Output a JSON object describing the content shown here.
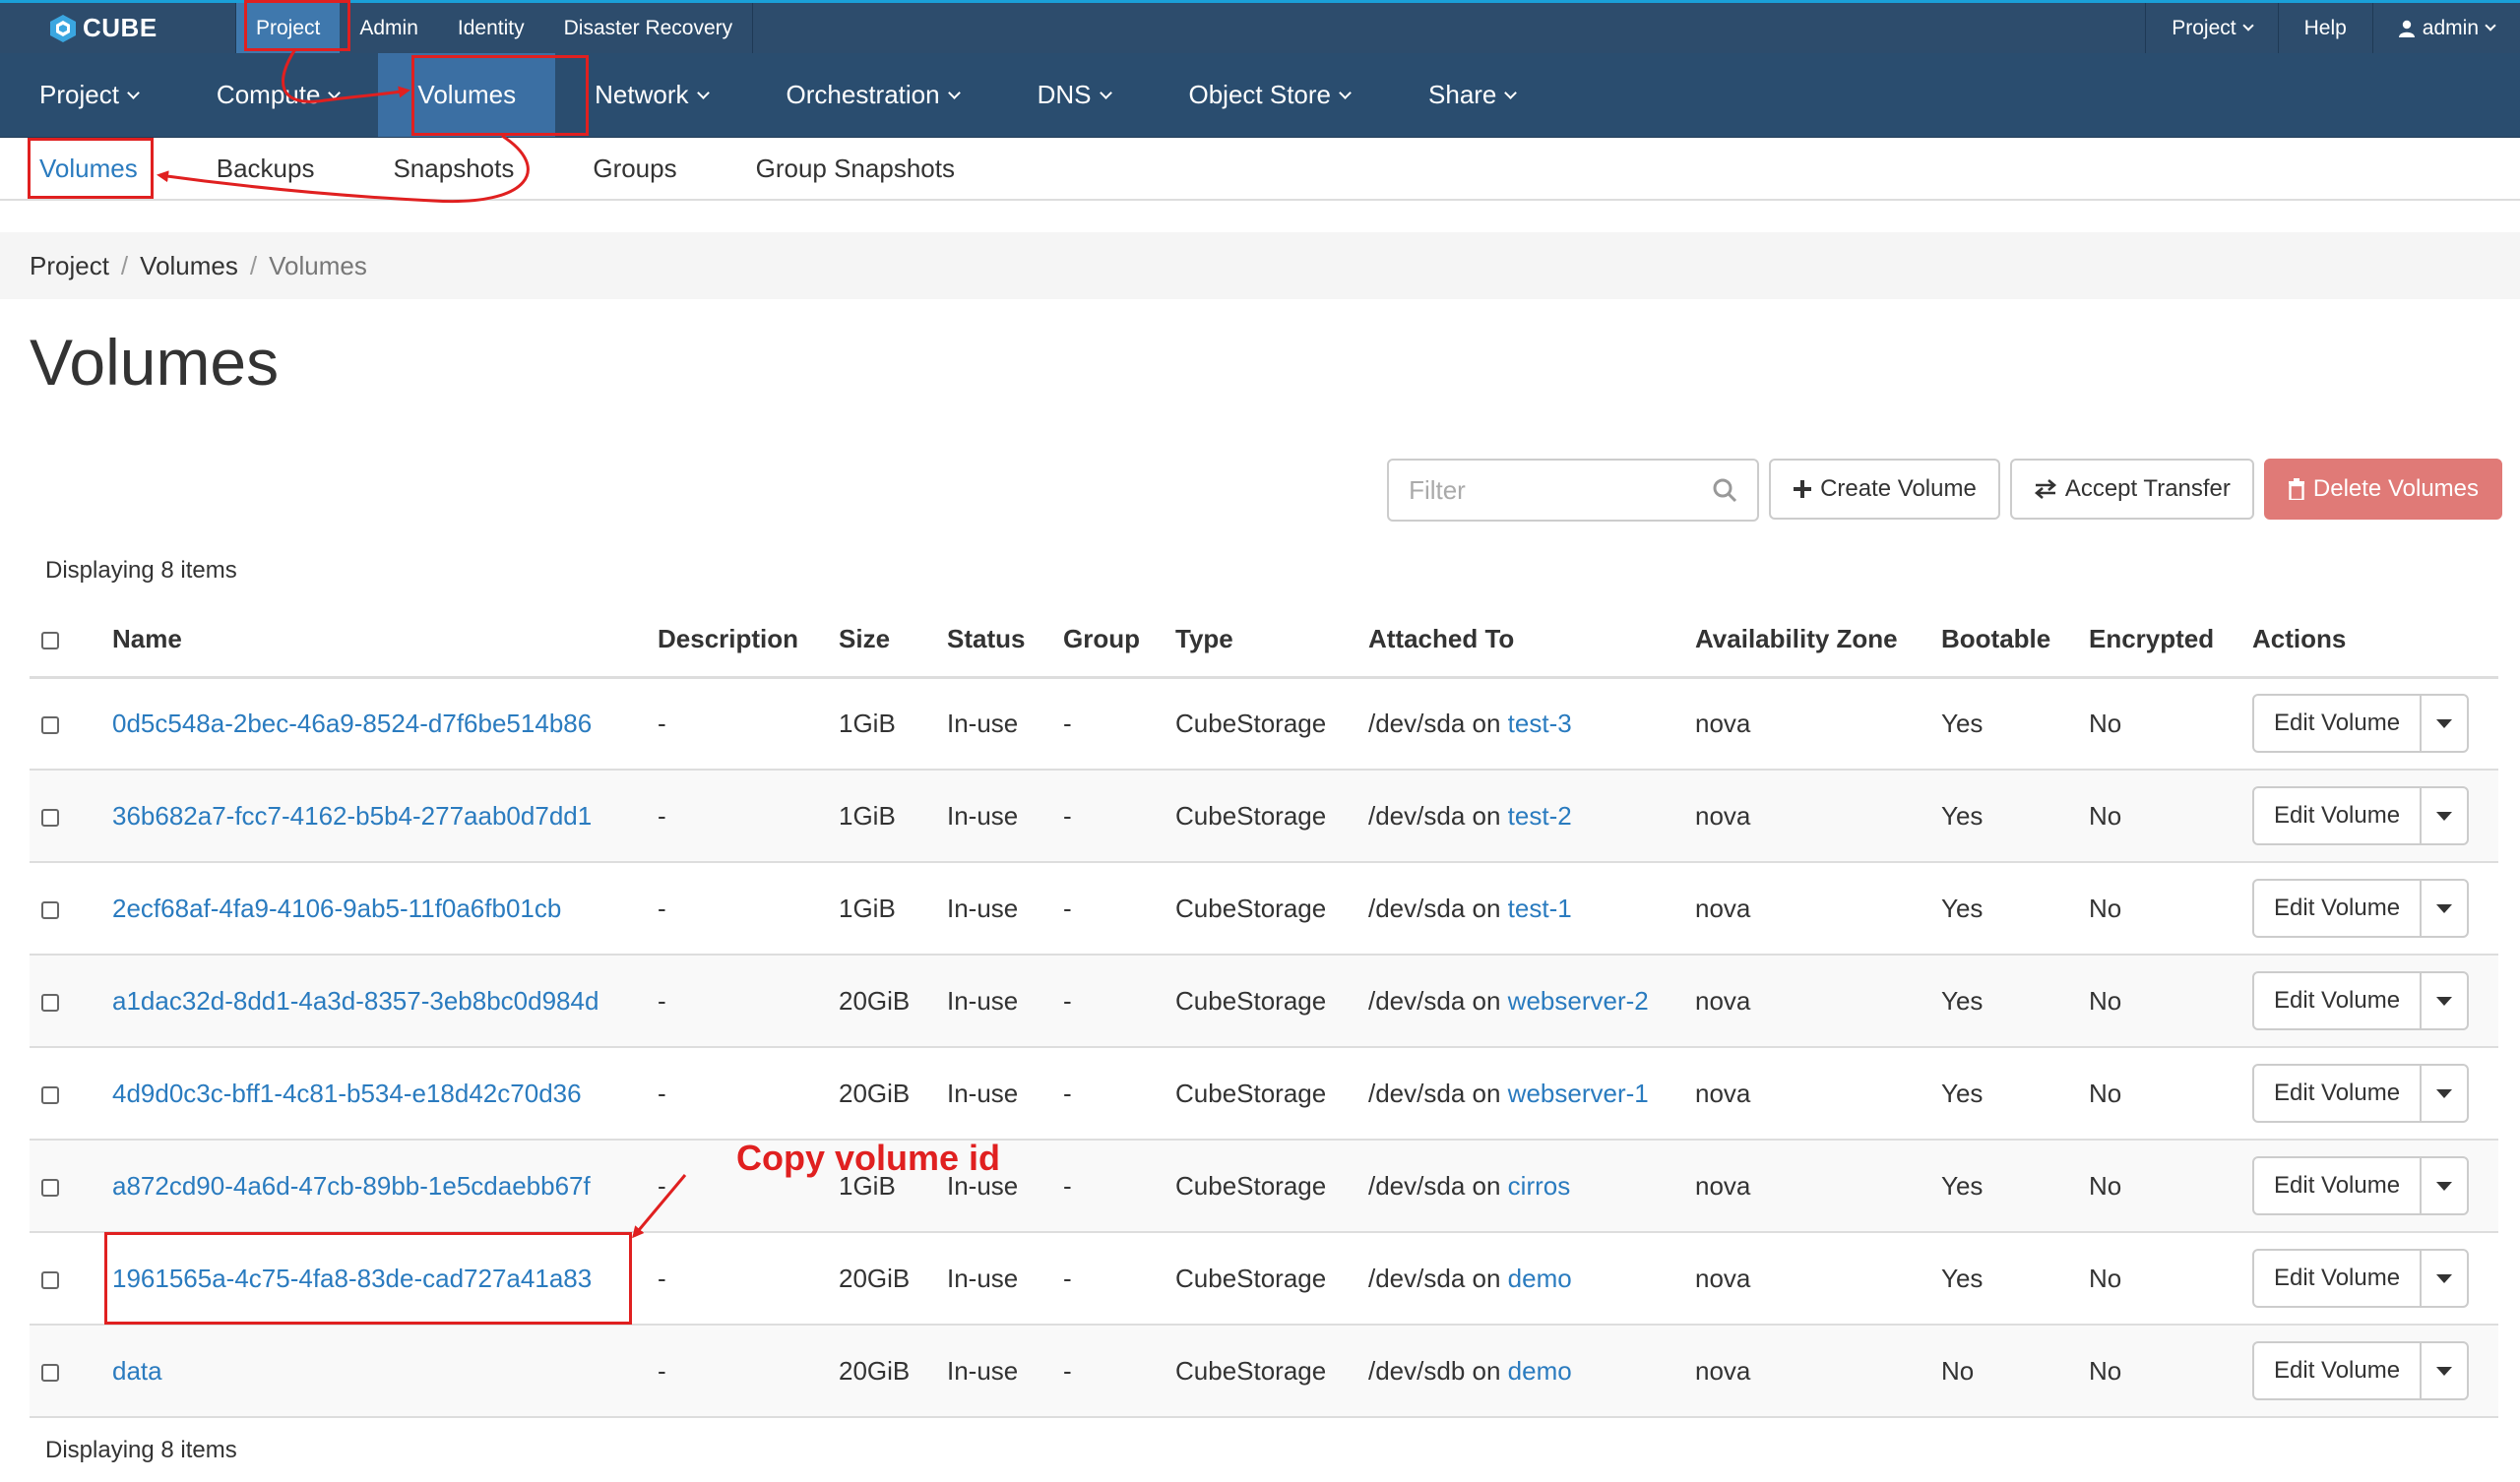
{
  "topbar": {
    "brand": "CUBE",
    "nav": [
      "Project",
      "Admin",
      "Identity",
      "Disaster Recovery"
    ],
    "right": {
      "project_menu": "Project",
      "help": "Help",
      "user": "admin"
    }
  },
  "mainnav": [
    "Project",
    "Compute",
    "Volumes",
    "Network",
    "Orchestration",
    "DNS",
    "Object Store",
    "Share"
  ],
  "subnav": [
    "Volumes",
    "Backups",
    "Snapshots",
    "Groups",
    "Group Snapshots"
  ],
  "breadcrumb": [
    "Project",
    "Volumes",
    "Volumes"
  ],
  "page_title": "Volumes",
  "toolbar": {
    "filter_placeholder": "Filter",
    "create": "Create Volume",
    "accept": "Accept Transfer",
    "delete": "Delete Volumes"
  },
  "count_text": "Displaying 8 items",
  "table": {
    "headers": [
      "Name",
      "Description",
      "Size",
      "Status",
      "Group",
      "Type",
      "Attached To",
      "Availability Zone",
      "Bootable",
      "Encrypted",
      "Actions"
    ],
    "action_label": "Edit Volume",
    "rows": [
      {
        "name": "0d5c548a-2bec-46a9-8524-d7f6be514b86",
        "desc": "-",
        "size": "1GiB",
        "status": "In-use",
        "group": "-",
        "type": "CubeStorage",
        "attach_prefix": "/dev/sda on",
        "attach_target": "test-3",
        "zone": "nova",
        "bootable": "Yes",
        "encrypted": "No"
      },
      {
        "name": "36b682a7-fcc7-4162-b5b4-277aab0d7dd1",
        "desc": "-",
        "size": "1GiB",
        "status": "In-use",
        "group": "-",
        "type": "CubeStorage",
        "attach_prefix": "/dev/sda on",
        "attach_target": "test-2",
        "zone": "nova",
        "bootable": "Yes",
        "encrypted": "No"
      },
      {
        "name": "2ecf68af-4fa9-4106-9ab5-11f0a6fb01cb",
        "desc": "-",
        "size": "1GiB",
        "status": "In-use",
        "group": "-",
        "type": "CubeStorage",
        "attach_prefix": "/dev/sda on",
        "attach_target": "test-1",
        "zone": "nova",
        "bootable": "Yes",
        "encrypted": "No"
      },
      {
        "name": "a1dac32d-8dd1-4a3d-8357-3eb8bc0d984d",
        "desc": "-",
        "size": "20GiB",
        "status": "In-use",
        "group": "-",
        "type": "CubeStorage",
        "attach_prefix": "/dev/sda on",
        "attach_target": "webserver-2",
        "zone": "nova",
        "bootable": "Yes",
        "encrypted": "No"
      },
      {
        "name": "4d9d0c3c-bff1-4c81-b534-e18d42c70d36",
        "desc": "-",
        "size": "20GiB",
        "status": "In-use",
        "group": "-",
        "type": "CubeStorage",
        "attach_prefix": "/dev/sda on",
        "attach_target": "webserver-1",
        "zone": "nova",
        "bootable": "Yes",
        "encrypted": "No"
      },
      {
        "name": "a872cd90-4a6d-47cb-89bb-1e5cdaebb67f",
        "desc": "-",
        "size": "1GiB",
        "status": "In-use",
        "group": "-",
        "type": "CubeStorage",
        "attach_prefix": "/dev/sda on",
        "attach_target": "cirros",
        "zone": "nova",
        "bootable": "Yes",
        "encrypted": "No"
      },
      {
        "name": "1961565a-4c75-4fa8-83de-cad727a41a83",
        "desc": "-",
        "size": "20GiB",
        "status": "In-use",
        "group": "-",
        "type": "CubeStorage",
        "attach_prefix": "/dev/sda on",
        "attach_target": "demo",
        "zone": "nova",
        "bootable": "Yes",
        "encrypted": "No"
      },
      {
        "name": "data",
        "desc": "-",
        "size": "20GiB",
        "status": "In-use",
        "group": "-",
        "type": "CubeStorage",
        "attach_prefix": "/dev/sdb on",
        "attach_target": "demo",
        "zone": "nova",
        "bootable": "No",
        "encrypted": "No"
      }
    ]
  },
  "annotation": {
    "text": "Copy volume id",
    "color": "#e02020"
  },
  "colors": {
    "topbar": "#2d4c6c",
    "active_nav": "#3b6fa3",
    "link": "#2a7bbf",
    "danger": "#e07a77"
  }
}
